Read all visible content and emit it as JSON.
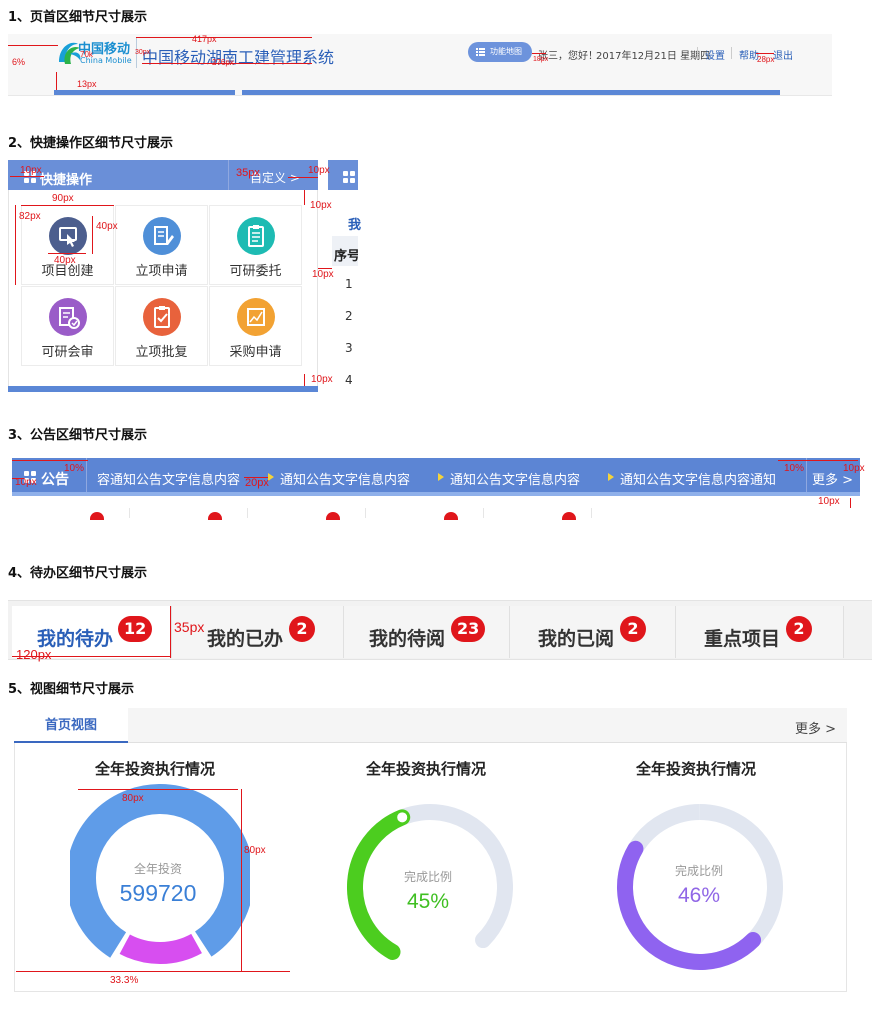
{
  "sections": {
    "s1": "1、页首区细节尺寸展示",
    "s2": "2、快捷操作区细节尺寸展示",
    "s3": "3、公告区细节尺寸展示",
    "s4": "4、待办区细节尺寸展示",
    "s5": "5、视图细节尺寸展示"
  },
  "header": {
    "logo_cn": "中国移动",
    "logo_en": "China Mobile",
    "system_title": "中国移动湖南工建管理系统",
    "nav_button": "功能地图",
    "user_greeting": "张三，您好！",
    "date": "2017年12月21日 星期四",
    "settings": "设置",
    "help": "帮助",
    "logout": "退出"
  },
  "quick": {
    "title": "快捷操作",
    "customize": "自定义 >",
    "tiles": [
      {
        "label": "项目创建",
        "color": "#4c5e8e",
        "icon": "hand-pointer-icon"
      },
      {
        "label": "立项申请",
        "color": "#4f8fd8",
        "icon": "edit-document-icon"
      },
      {
        "label": "可研委托",
        "color": "#1ebbb3",
        "icon": "clipboard-icon"
      },
      {
        "label": "可研会审",
        "color": "#9a5cc8",
        "icon": "review-document-icon"
      },
      {
        "label": "立项批复",
        "color": "#e8623c",
        "icon": "approve-clipboard-icon"
      },
      {
        "label": "采购申请",
        "color": "#f2a233",
        "icon": "chart-icon"
      }
    ],
    "side_table": {
      "head_fragment": "我",
      "col": "序号",
      "rows": [
        "1",
        "2",
        "3",
        "4"
      ]
    }
  },
  "notice": {
    "title": "公告",
    "items": [
      "容通知公告文字信息内容",
      "通知公告文字信息内容",
      "通知公告文字信息内容",
      "通知公告文字信息内容通知"
    ],
    "more": "更多 >"
  },
  "todo": {
    "tabs": [
      {
        "label": "我的待办",
        "count": "12"
      },
      {
        "label": "我的已办",
        "count": "2"
      },
      {
        "label": "我的待阅",
        "count": "23"
      },
      {
        "label": "我的已阅",
        "count": "2"
      },
      {
        "label": "重点项目",
        "count": "2"
      }
    ]
  },
  "view": {
    "tab": "首页视图",
    "more": "更多 >",
    "charts": [
      {
        "title": "全年投资执行情况",
        "caption": "全年投资",
        "value": "599720",
        "value_color": "#3a7fd6"
      },
      {
        "title": "全年投资执行情况",
        "caption": "完成比例",
        "value": "45%",
        "value_color": "#3fbf22"
      },
      {
        "title": "全年投资执行情况",
        "caption": "完成比例",
        "value": "46%",
        "value_color": "#9066e6"
      }
    ]
  },
  "chart_data": [
    {
      "type": "pie",
      "title": "全年投资执行情况",
      "center_label": "全年投资",
      "center_value": 599720,
      "slices": [
        {
          "name": "",
          "value": 83,
          "color": "#5f9ce8"
        },
        {
          "name": "",
          "value": 17,
          "color": "#d74ef0"
        }
      ]
    },
    {
      "type": "pie",
      "title": "全年投资执行情况",
      "center_label": "完成比例",
      "progress_percent": 45,
      "color": "#4ccd1f",
      "track_color": "#e1e6f0"
    },
    {
      "type": "pie",
      "title": "全年投资执行情况",
      "center_label": "完成比例",
      "progress_percent": 46,
      "color": "#8f63f0",
      "track_color": "#e1e6f0"
    }
  ],
  "annotations": {
    "s1": [
      "6%",
      "417px",
      "70k",
      "30px",
      "276px",
      "13px",
      "18px",
      "28px"
    ],
    "s2": [
      "10px",
      "35px",
      "10px",
      "10px",
      "90px",
      "82px",
      "40px",
      "40px",
      "10px",
      "10px"
    ],
    "s3": [
      "10%",
      "10px",
      "20px",
      "10%",
      "10px",
      "10px"
    ],
    "s4": [
      "35px",
      "120px"
    ],
    "s5": [
      "80px",
      "80px",
      "33.3%"
    ]
  }
}
